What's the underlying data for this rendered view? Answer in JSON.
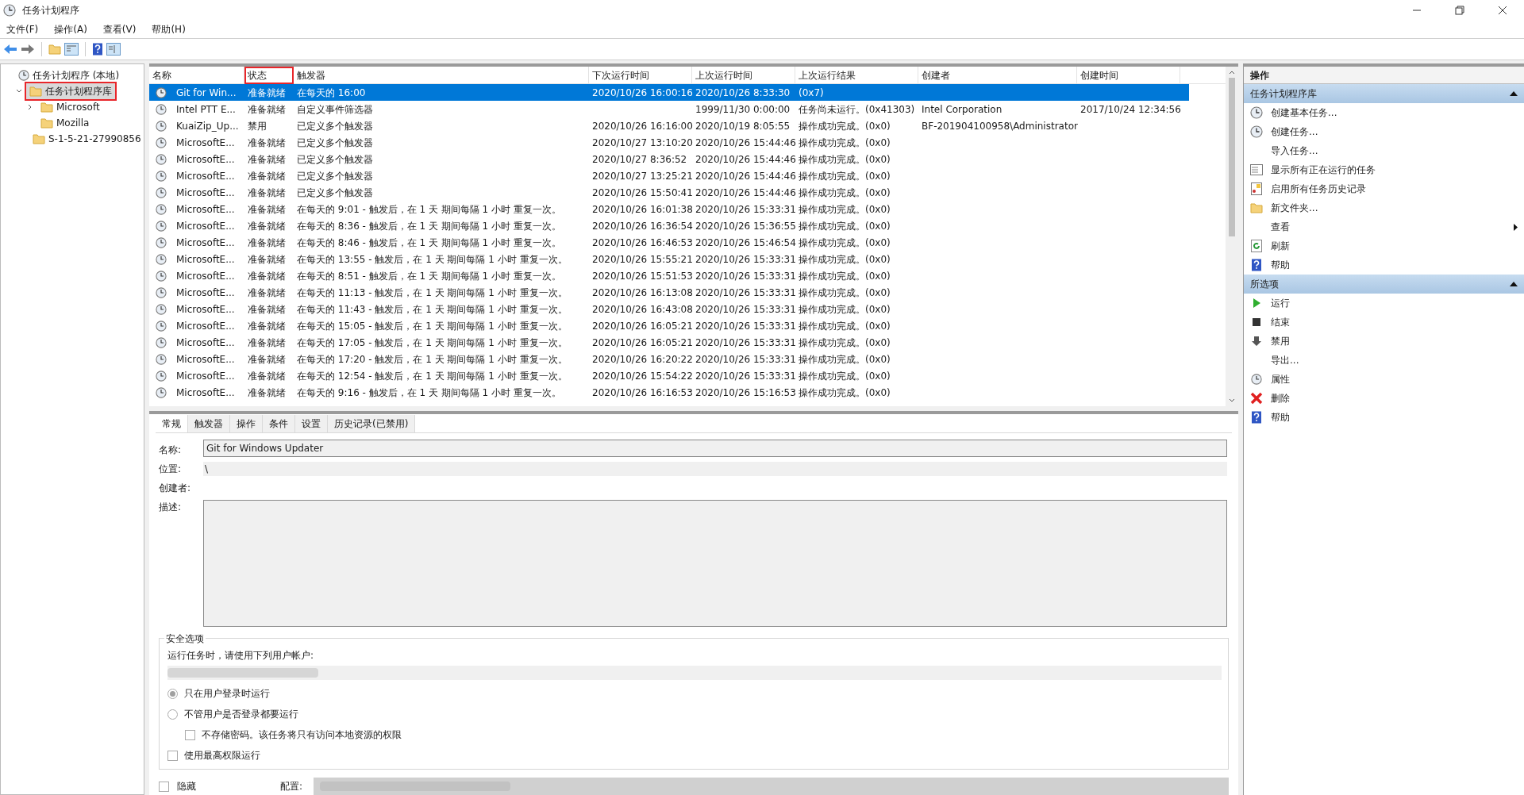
{
  "window": {
    "title": "任务计划程序"
  },
  "menu": [
    "文件(F)",
    "操作(A)",
    "查看(V)",
    "帮助(H)"
  ],
  "tree": [
    {
      "label": "任务计划程序 (本地)",
      "selected": false,
      "highlighted": false,
      "children": [
        {
          "label": "任务计划程序库",
          "selected": true,
          "highlighted": true,
          "expanded": true,
          "children": [
            {
              "label": "Microsoft",
              "selected": false,
              "highlighted": false,
              "expanded": false
            },
            {
              "label": "Mozilla",
              "selected": false,
              "highlighted": false
            },
            {
              "label": "S-1-5-21-27990856",
              "selected": false,
              "highlighted": false
            }
          ]
        }
      ]
    }
  ],
  "table": {
    "columns": [
      {
        "label": "名称",
        "highlighted": false
      },
      {
        "label": "状态",
        "highlighted": true
      },
      {
        "label": "触发器",
        "highlighted": false
      },
      {
        "label": "下次运行时间",
        "highlighted": false
      },
      {
        "label": "上次运行时间",
        "highlighted": false
      },
      {
        "label": "上次运行结果",
        "highlighted": false
      },
      {
        "label": "创建者",
        "highlighted": false
      },
      {
        "label": "创建时间",
        "highlighted": false
      }
    ],
    "rows": [
      {
        "selected": true,
        "name": "Git for Win...",
        "status": "准备就绪",
        "trigger": "在每天的 16:00",
        "next_run": "2020/10/26 16:00:16",
        "last_run": "2020/10/26 8:33:30",
        "last_result": "(0x7)"
      },
      {
        "selected": false,
        "name": "Intel PTT E...",
        "status": "准备就绪",
        "trigger": "自定义事件筛选器",
        "last_run": "1999/11/30 0:00:00",
        "last_result": "任务尚未运行。(0x41303)",
        "author": "Intel Corporation",
        "created": "2017/10/24 12:34:56"
      },
      {
        "selected": false,
        "name": "KuaiZip_Up...",
        "status": "禁用",
        "trigger": "已定义多个触发器",
        "next_run": "2020/10/26 16:16:00",
        "last_run": "2020/10/19 8:05:55",
        "last_result": "操作成功完成。(0x0)",
        "author": "BF-201904100958\\Administrator"
      },
      {
        "selected": false,
        "name": "MicrosoftE...",
        "status": "准备就绪",
        "trigger": "已定义多个触发器",
        "next_run": "2020/10/27 13:10:20",
        "last_run": "2020/10/26 15:44:46",
        "last_result": "操作成功完成。(0x0)"
      },
      {
        "selected": false,
        "name": "MicrosoftE...",
        "status": "准备就绪",
        "trigger": "已定义多个触发器",
        "next_run": "2020/10/27 8:36:52",
        "last_run": "2020/10/26 15:44:46",
        "last_result": "操作成功完成。(0x0)"
      },
      {
        "selected": false,
        "name": "MicrosoftE...",
        "status": "准备就绪",
        "trigger": "已定义多个触发器",
        "next_run": "2020/10/27 13:25:21",
        "last_run": "2020/10/26 15:44:46",
        "last_result": "操作成功完成。(0x0)"
      },
      {
        "selected": false,
        "name": "MicrosoftE...",
        "status": "准备就绪",
        "trigger": "已定义多个触发器",
        "next_run": "2020/10/26 15:50:41",
        "last_run": "2020/10/26 15:44:46",
        "last_result": "操作成功完成。(0x0)"
      },
      {
        "selected": false,
        "name": "MicrosoftE...",
        "status": "准备就绪",
        "trigger": "在每天的 9:01 - 触发后，在 1 天 期间每隔 1 小时 重复一次。",
        "next_run": "2020/10/26 16:01:38",
        "last_run": "2020/10/26 15:33:31",
        "last_result": "操作成功完成。(0x0)"
      },
      {
        "selected": false,
        "name": "MicrosoftE...",
        "status": "准备就绪",
        "trigger": "在每天的 8:36 - 触发后，在 1 天 期间每隔 1 小时 重复一次。",
        "next_run": "2020/10/26 16:36:54",
        "last_run": "2020/10/26 15:36:55",
        "last_result": "操作成功完成。(0x0)"
      },
      {
        "selected": false,
        "name": "MicrosoftE...",
        "status": "准备就绪",
        "trigger": "在每天的 8:46 - 触发后，在 1 天 期间每隔 1 小时 重复一次。",
        "next_run": "2020/10/26 16:46:53",
        "last_run": "2020/10/26 15:46:54",
        "last_result": "操作成功完成。(0x0)"
      },
      {
        "selected": false,
        "name": "MicrosoftE...",
        "status": "准备就绪",
        "trigger": "在每天的 13:55 - 触发后，在 1 天 期间每隔 1 小时 重复一次。",
        "next_run": "2020/10/26 15:55:21",
        "last_run": "2020/10/26 15:33:31",
        "last_result": "操作成功完成。(0x0)"
      },
      {
        "selected": false,
        "name": "MicrosoftE...",
        "status": "准备就绪",
        "trigger": "在每天的 8:51 - 触发后，在 1 天 期间每隔 1 小时 重复一次。",
        "next_run": "2020/10/26 15:51:53",
        "last_run": "2020/10/26 15:33:31",
        "last_result": "操作成功完成。(0x0)"
      },
      {
        "selected": false,
        "name": "MicrosoftE...",
        "status": "准备就绪",
        "trigger": "在每天的 11:13 - 触发后，在 1 天 期间每隔 1 小时 重复一次。",
        "next_run": "2020/10/26 16:13:08",
        "last_run": "2020/10/26 15:33:31",
        "last_result": "操作成功完成。(0x0)"
      },
      {
        "selected": false,
        "name": "MicrosoftE...",
        "status": "准备就绪",
        "trigger": "在每天的 11:43 - 触发后，在 1 天 期间每隔 1 小时 重复一次。",
        "next_run": "2020/10/26 16:43:08",
        "last_run": "2020/10/26 15:33:31",
        "last_result": "操作成功完成。(0x0)"
      },
      {
        "selected": false,
        "name": "MicrosoftE...",
        "status": "准备就绪",
        "trigger": "在每天的 15:05 - 触发后，在 1 天 期间每隔 1 小时 重复一次。",
        "next_run": "2020/10/26 16:05:21",
        "last_run": "2020/10/26 15:33:31",
        "last_result": "操作成功完成。(0x0)"
      },
      {
        "selected": false,
        "name": "MicrosoftE...",
        "status": "准备就绪",
        "trigger": "在每天的 17:05 - 触发后，在 1 天 期间每隔 1 小时 重复一次。",
        "next_run": "2020/10/26 16:05:21",
        "last_run": "2020/10/26 15:33:31",
        "last_result": "操作成功完成。(0x0)"
      },
      {
        "selected": false,
        "name": "MicrosoftE...",
        "status": "准备就绪",
        "trigger": "在每天的 17:20 - 触发后，在 1 天 期间每隔 1 小时 重复一次。",
        "next_run": "2020/10/26 16:20:22",
        "last_run": "2020/10/26 15:33:31",
        "last_result": "操作成功完成。(0x0)"
      },
      {
        "selected": false,
        "name": "MicrosoftE...",
        "status": "准备就绪",
        "trigger": "在每天的 12:54 - 触发后，在 1 天 期间每隔 1 小时 重复一次。",
        "next_run": "2020/10/26 15:54:22",
        "last_run": "2020/10/26 15:33:31",
        "last_result": "操作成功完成。(0x0)"
      },
      {
        "selected": false,
        "name": "MicrosoftE...",
        "status": "准备就绪",
        "trigger": "在每天的 9:16 - 触发后，在 1 天 期间每隔 1 小时 重复一次。",
        "next_run": "2020/10/26 16:16:53",
        "last_run": "2020/10/26 15:16:53",
        "last_result": "操作成功完成。(0x0)"
      }
    ]
  },
  "details": {
    "tabs": [
      {
        "label": "常规",
        "selected": true
      },
      {
        "label": "触发器",
        "selected": false
      },
      {
        "label": "操作",
        "selected": false
      },
      {
        "label": "条件",
        "selected": false
      },
      {
        "label": "设置",
        "selected": false
      },
      {
        "label": "历史记录(已禁用)",
        "selected": false
      }
    ],
    "name_label": "名称:",
    "name_value": "Git for Windows Updater",
    "location_label": "位置:",
    "location_value": "\\",
    "author_label": "创建者:",
    "description_label": "描述:",
    "security": {
      "title": "安全选项",
      "account_prompt": "运行任务时，请使用下列用户帐户:",
      "options": [
        {
          "kind": "radio",
          "label": "只在用户登录时运行",
          "selected": true
        },
        {
          "kind": "radio",
          "label": "不管用户是否登录都要运行",
          "selected": false
        },
        {
          "kind": "checkbox",
          "label": "不存储密码。该任务将只有访问本地资源的权限",
          "checked": false,
          "indent": true
        },
        {
          "kind": "checkbox",
          "label": "使用最高权限运行",
          "checked": false
        }
      ]
    },
    "hidden": {
      "label": "隐藏",
      "checked": false
    },
    "config_label": "配置:"
  },
  "actions": {
    "title": "操作",
    "sections": [
      {
        "title": "任务计划程序库",
        "expanded": true,
        "items": [
          {
            "label": "创建基本任务...",
            "submenu": false
          },
          {
            "label": "创建任务...",
            "submenu": false
          },
          {
            "label": "导入任务...",
            "submenu": false
          },
          {
            "label": "显示所有正在运行的任务",
            "submenu": false
          },
          {
            "label": "启用所有任务历史记录",
            "submenu": false
          },
          {
            "label": "新文件夹...",
            "submenu": false
          },
          {
            "label": "查看",
            "submenu": true
          },
          {
            "label": "刷新",
            "submenu": false
          },
          {
            "label": "帮助",
            "submenu": false
          }
        ]
      },
      {
        "title": "所选项",
        "expanded": true,
        "items": [
          {
            "label": "运行",
            "submenu": false
          },
          {
            "label": "结束",
            "submenu": false
          },
          {
            "label": "禁用",
            "submenu": false
          },
          {
            "label": "导出...",
            "submenu": false
          },
          {
            "label": "属性",
            "submenu": false
          },
          {
            "label": "删除",
            "submenu": false
          },
          {
            "label": "帮助",
            "submenu": false
          }
        ]
      }
    ]
  }
}
